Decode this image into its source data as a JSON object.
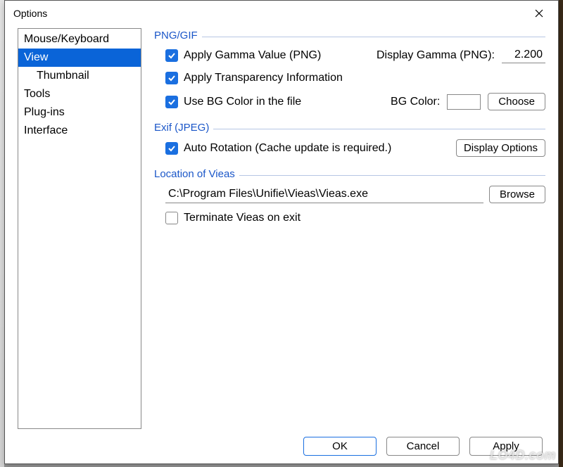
{
  "window": {
    "title": "Options"
  },
  "sidebar": {
    "items": [
      {
        "label": "Mouse/Keyboard",
        "selected": false,
        "indent": false
      },
      {
        "label": "View",
        "selected": true,
        "indent": false
      },
      {
        "label": "Thumbnail",
        "selected": false,
        "indent": true
      },
      {
        "label": "Tools",
        "selected": false,
        "indent": false
      },
      {
        "label": "Plug-ins",
        "selected": false,
        "indent": false
      },
      {
        "label": "Interface",
        "selected": false,
        "indent": false
      }
    ]
  },
  "groups": {
    "png": {
      "title": "PNG/GIF",
      "apply_gamma": {
        "label": "Apply Gamma Value (PNG)",
        "checked": true
      },
      "display_gamma_label": "Display Gamma (PNG):",
      "display_gamma_value": "2.200",
      "apply_transparency": {
        "label": "Apply Transparency Information",
        "checked": true
      },
      "use_bg_color": {
        "label": "Use BG Color in the file",
        "checked": true
      },
      "bg_color_label": "BG Color:",
      "bg_color_value": "#ffffff",
      "choose_label": "Choose"
    },
    "exif": {
      "title": "Exif (JPEG)",
      "auto_rotation": {
        "label": "Auto Rotation (Cache update is required.)",
        "checked": true
      },
      "display_options_label": "Display Options"
    },
    "vieas": {
      "title": "Location of Vieas",
      "path": "C:\\Program Files\\Unifie\\Vieas\\Vieas.exe",
      "browse_label": "Browse",
      "terminate": {
        "label": "Terminate Vieas on exit",
        "checked": false
      }
    }
  },
  "footer": {
    "ok": "OK",
    "cancel": "Cancel",
    "apply": "Apply"
  },
  "watermark": "LO4D.com"
}
